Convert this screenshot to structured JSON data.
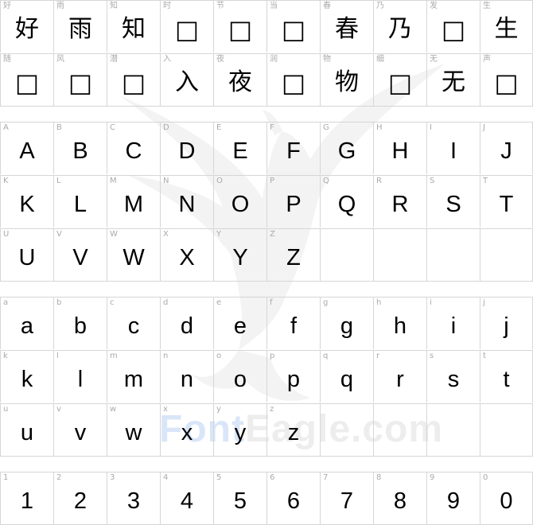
{
  "watermark": {
    "brand_part1": "Font",
    "brand_part2": "Eagle",
    "domain": ".com"
  },
  "sections": [
    {
      "name": "chinese",
      "rows": [
        [
          {
            "label": "好",
            "glyph": "好"
          },
          {
            "label": "雨",
            "glyph": "雨"
          },
          {
            "label": "知",
            "glyph": "知"
          },
          {
            "label": "时",
            "glyph": "□"
          },
          {
            "label": "节",
            "glyph": "□"
          },
          {
            "label": "当",
            "glyph": "□"
          },
          {
            "label": "春",
            "glyph": "春"
          },
          {
            "label": "乃",
            "glyph": "乃"
          },
          {
            "label": "发",
            "glyph": "□"
          },
          {
            "label": "生",
            "glyph": "生"
          }
        ],
        [
          {
            "label": "随",
            "glyph": "□"
          },
          {
            "label": "风",
            "glyph": "□"
          },
          {
            "label": "潜",
            "glyph": "□"
          },
          {
            "label": "入",
            "glyph": "入"
          },
          {
            "label": "夜",
            "glyph": "夜"
          },
          {
            "label": "润",
            "glyph": "□"
          },
          {
            "label": "物",
            "glyph": "物"
          },
          {
            "label": "细",
            "glyph": "□"
          },
          {
            "label": "无",
            "glyph": "无"
          },
          {
            "label": "声",
            "glyph": "□"
          }
        ]
      ]
    },
    {
      "name": "uppercase",
      "rows": [
        [
          {
            "label": "A",
            "glyph": "A"
          },
          {
            "label": "B",
            "glyph": "B"
          },
          {
            "label": "C",
            "glyph": "C"
          },
          {
            "label": "D",
            "glyph": "D"
          },
          {
            "label": "E",
            "glyph": "E"
          },
          {
            "label": "F",
            "glyph": "F"
          },
          {
            "label": "G",
            "glyph": "G"
          },
          {
            "label": "H",
            "glyph": "H"
          },
          {
            "label": "I",
            "glyph": "I"
          },
          {
            "label": "J",
            "glyph": "J"
          }
        ],
        [
          {
            "label": "K",
            "glyph": "K"
          },
          {
            "label": "L",
            "glyph": "L"
          },
          {
            "label": "M",
            "glyph": "M"
          },
          {
            "label": "N",
            "glyph": "N"
          },
          {
            "label": "O",
            "glyph": "O"
          },
          {
            "label": "P",
            "glyph": "P"
          },
          {
            "label": "Q",
            "glyph": "Q"
          },
          {
            "label": "R",
            "glyph": "R"
          },
          {
            "label": "S",
            "glyph": "S"
          },
          {
            "label": "T",
            "glyph": "T"
          }
        ],
        [
          {
            "label": "U",
            "glyph": "U"
          },
          {
            "label": "V",
            "glyph": "V"
          },
          {
            "label": "W",
            "glyph": "W"
          },
          {
            "label": "X",
            "glyph": "X"
          },
          {
            "label": "Y",
            "glyph": "Y"
          },
          {
            "label": "Z",
            "glyph": "Z"
          },
          {
            "label": "",
            "glyph": ""
          },
          {
            "label": "",
            "glyph": ""
          },
          {
            "label": "",
            "glyph": ""
          },
          {
            "label": "",
            "glyph": ""
          }
        ]
      ]
    },
    {
      "name": "lowercase",
      "rows": [
        [
          {
            "label": "a",
            "glyph": "a"
          },
          {
            "label": "b",
            "glyph": "b"
          },
          {
            "label": "c",
            "glyph": "c"
          },
          {
            "label": "d",
            "glyph": "d"
          },
          {
            "label": "e",
            "glyph": "e"
          },
          {
            "label": "f",
            "glyph": "f"
          },
          {
            "label": "g",
            "glyph": "g"
          },
          {
            "label": "h",
            "glyph": "h"
          },
          {
            "label": "i",
            "glyph": "i"
          },
          {
            "label": "j",
            "glyph": "j"
          }
        ],
        [
          {
            "label": "k",
            "glyph": "k"
          },
          {
            "label": "l",
            "glyph": "l"
          },
          {
            "label": "m",
            "glyph": "m"
          },
          {
            "label": "n",
            "glyph": "n"
          },
          {
            "label": "o",
            "glyph": "o"
          },
          {
            "label": "p",
            "glyph": "p"
          },
          {
            "label": "q",
            "glyph": "q"
          },
          {
            "label": "r",
            "glyph": "r"
          },
          {
            "label": "s",
            "glyph": "s"
          },
          {
            "label": "t",
            "glyph": "t"
          }
        ],
        [
          {
            "label": "u",
            "glyph": "u"
          },
          {
            "label": "v",
            "glyph": "v"
          },
          {
            "label": "w",
            "glyph": "w"
          },
          {
            "label": "x",
            "glyph": "x"
          },
          {
            "label": "y",
            "glyph": "y"
          },
          {
            "label": "z",
            "glyph": "z"
          },
          {
            "label": "",
            "glyph": ""
          },
          {
            "label": "",
            "glyph": ""
          },
          {
            "label": "",
            "glyph": ""
          },
          {
            "label": "",
            "glyph": ""
          }
        ]
      ]
    },
    {
      "name": "digits",
      "rows": [
        [
          {
            "label": "1",
            "glyph": "1"
          },
          {
            "label": "2",
            "glyph": "2"
          },
          {
            "label": "3",
            "glyph": "3"
          },
          {
            "label": "4",
            "glyph": "4"
          },
          {
            "label": "5",
            "glyph": "5"
          },
          {
            "label": "6",
            "glyph": "6"
          },
          {
            "label": "7",
            "glyph": "7"
          },
          {
            "label": "8",
            "glyph": "8"
          },
          {
            "label": "9",
            "glyph": "9"
          },
          {
            "label": "0",
            "glyph": "0"
          }
        ]
      ]
    }
  ]
}
